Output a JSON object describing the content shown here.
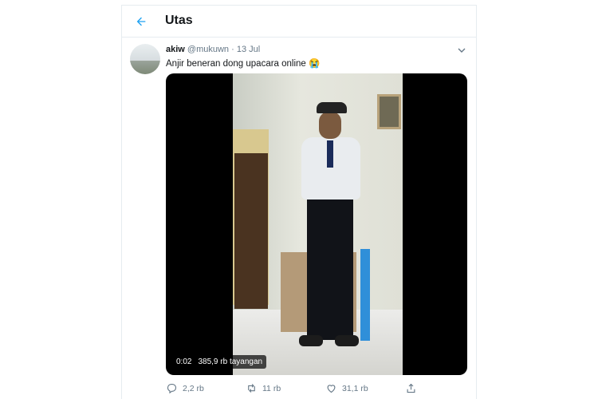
{
  "header": {
    "title": "Utas",
    "back_icon": "arrow-left-icon"
  },
  "tweet": {
    "display_name": "akiw",
    "handle": "@mukuwn",
    "separator": "·",
    "date": "13 Jul",
    "text": "Anjir beneran dong upacara online 😭",
    "video": {
      "time": "0:02",
      "views": "385,9 rb tayangan"
    },
    "actions": {
      "reply": {
        "icon": "reply-icon",
        "count": "2,2 rb"
      },
      "retweet": {
        "icon": "retweet-icon",
        "count": "11 rb"
      },
      "like": {
        "icon": "heart-icon",
        "count": "31,1 rb"
      },
      "share": {
        "icon": "share-icon"
      }
    }
  },
  "colors": {
    "accent": "#1da1f2",
    "muted": "#657786",
    "border": "#e6ecf0"
  }
}
